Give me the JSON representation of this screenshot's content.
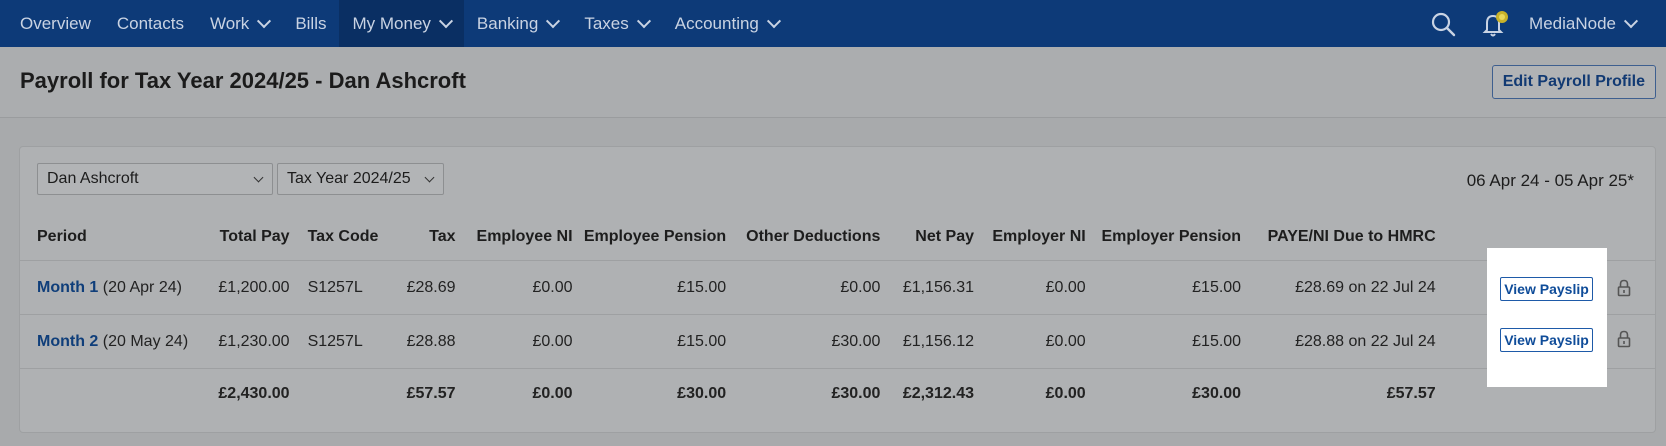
{
  "nav": {
    "items": [
      {
        "label": "Overview",
        "dropdown": false,
        "active": false
      },
      {
        "label": "Contacts",
        "dropdown": false,
        "active": false
      },
      {
        "label": "Work",
        "dropdown": true,
        "active": false
      },
      {
        "label": "Bills",
        "dropdown": false,
        "active": false
      },
      {
        "label": "My Money",
        "dropdown": true,
        "active": true
      },
      {
        "label": "Banking",
        "dropdown": true,
        "active": false
      },
      {
        "label": "Taxes",
        "dropdown": true,
        "active": false
      },
      {
        "label": "Accounting",
        "dropdown": true,
        "active": false
      }
    ],
    "account": "MediaNode",
    "icons": [
      "search-icon",
      "bell-icon"
    ]
  },
  "header": {
    "title": "Payroll for Tax Year 2024/25 - Dan Ashcroft",
    "edit_button": "Edit Payroll Profile"
  },
  "filters": {
    "employee": "Dan Ashcroft",
    "tax_year": "Tax Year 2024/25",
    "date_range": "06 Apr 24 - 05 Apr 25*"
  },
  "table": {
    "columns": [
      "Period",
      "Total Pay",
      "Tax Code",
      "Tax",
      "Employee NI",
      "Employee Pension",
      "Other Deductions",
      "Net Pay",
      "Employer NI",
      "Employer Pension",
      "PAYE/NI Due to HMRC"
    ],
    "rows": [
      {
        "period_link": "Month 1",
        "period_date": "(20 Apr 24)",
        "total_pay": "£1,200.00",
        "tax_code": "S1257L",
        "tax": "£28.69",
        "employee_ni": "£0.00",
        "employee_pension": "£15.00",
        "other_deductions": "£0.00",
        "net_pay": "£1,156.31",
        "employer_ni": "£0.00",
        "employer_pension": "£15.00",
        "paye_due": "£28.69 on 22 Jul 24",
        "payslip": "View Payslip"
      },
      {
        "period_link": "Month 2",
        "period_date": "(20 May 24)",
        "total_pay": "£1,230.00",
        "tax_code": "S1257L",
        "tax": "£28.88",
        "employee_ni": "£0.00",
        "employee_pension": "£15.00",
        "other_deductions": "£30.00",
        "net_pay": "£1,156.12",
        "employer_ni": "£0.00",
        "employer_pension": "£15.00",
        "paye_due": "£28.88 on 22 Jul 24",
        "payslip": "View Payslip"
      }
    ],
    "totals": {
      "total_pay": "£2,430.00",
      "tax": "£57.57",
      "employee_ni": "£0.00",
      "employee_pension": "£30.00",
      "other_deductions": "£30.00",
      "net_pay": "£2,312.43",
      "employer_ni": "£0.00",
      "employer_pension": "£30.00",
      "paye_due": "£57.57"
    }
  },
  "colors": {
    "nav_bg": "#0d3a78",
    "link": "#0f3e7a",
    "highlight": "#ffffff"
  }
}
